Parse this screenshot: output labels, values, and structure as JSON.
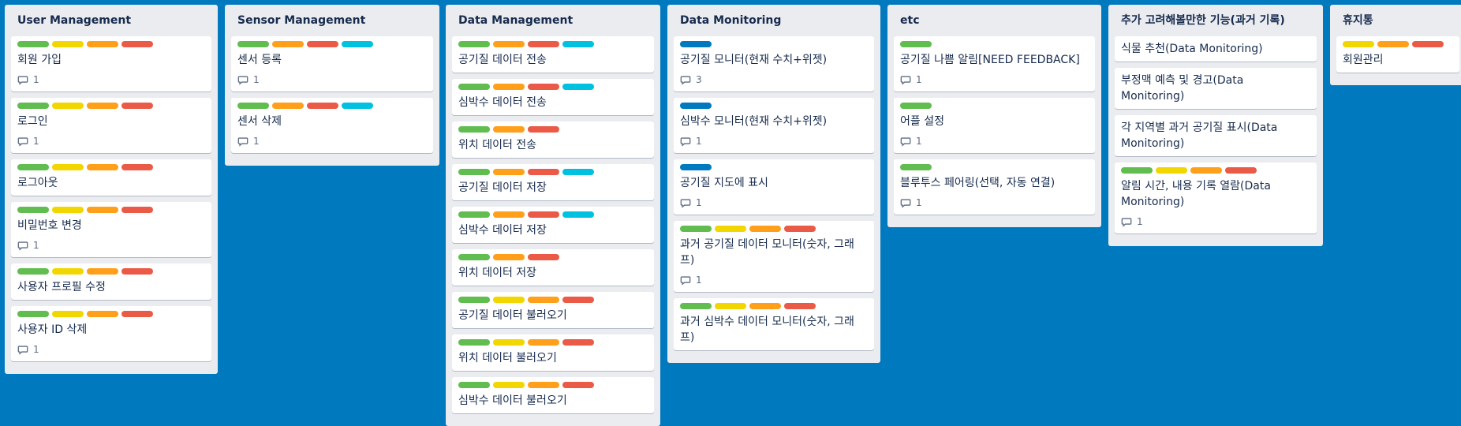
{
  "colors": {
    "background": "#0079bf",
    "list_bg": "#ebecf0",
    "card_bg": "#ffffff",
    "label_green": "#61bd4f",
    "label_yellow": "#f2d600",
    "label_orange": "#ff9f1a",
    "label_red": "#eb5a46",
    "label_sky": "#00c2e0",
    "label_blue": "#0079bf"
  },
  "lists": [
    {
      "title": "User Management",
      "cards": [
        {
          "title": "회원 가입",
          "labels": [
            "green",
            "yellow",
            "orange",
            "red"
          ],
          "comments": "1"
        },
        {
          "title": "로그인",
          "labels": [
            "green",
            "yellow",
            "orange",
            "red"
          ],
          "comments": "1"
        },
        {
          "title": "로그아웃",
          "labels": [
            "green",
            "yellow",
            "orange",
            "red"
          ],
          "comments": null
        },
        {
          "title": "비밀번호 변경",
          "labels": [
            "green",
            "yellow",
            "orange",
            "red"
          ],
          "comments": "1"
        },
        {
          "title": "사용자 프로필 수정",
          "labels": [
            "green",
            "yellow",
            "orange",
            "red"
          ],
          "comments": null
        },
        {
          "title": "사용자 ID 삭제",
          "labels": [
            "green",
            "yellow",
            "orange",
            "red"
          ],
          "comments": "1"
        }
      ]
    },
    {
      "title": "Sensor Management",
      "cards": [
        {
          "title": "센서 등록",
          "labels": [
            "green",
            "orange",
            "red",
            "sky"
          ],
          "comments": "1"
        },
        {
          "title": "센서 삭제",
          "labels": [
            "green",
            "orange",
            "red",
            "sky"
          ],
          "comments": "1"
        }
      ]
    },
    {
      "title": "Data Management",
      "cards": [
        {
          "title": "공기질 데이터 전송",
          "labels": [
            "green",
            "orange",
            "red",
            "sky"
          ],
          "comments": null
        },
        {
          "title": "심박수 데이터 전송",
          "labels": [
            "green",
            "orange",
            "red",
            "sky"
          ],
          "comments": null
        },
        {
          "title": "위치 데이터 전송",
          "labels": [
            "green",
            "orange",
            "red"
          ],
          "comments": null
        },
        {
          "title": "공기질 데이터 저장",
          "labels": [
            "green",
            "orange",
            "red",
            "sky"
          ],
          "comments": null
        },
        {
          "title": "심박수 데이터 저장",
          "labels": [
            "green",
            "orange",
            "red",
            "sky"
          ],
          "comments": null
        },
        {
          "title": "위치 데이터 저장",
          "labels": [
            "green",
            "orange",
            "red"
          ],
          "comments": null
        },
        {
          "title": "공기질 데이터 불러오기",
          "labels": [
            "green",
            "yellow",
            "orange",
            "red"
          ],
          "comments": null
        },
        {
          "title": "위치 데이터 불러오기",
          "labels": [
            "green",
            "yellow",
            "orange",
            "red"
          ],
          "comments": null
        },
        {
          "title": "심박수 데이터 불러오기",
          "labels": [
            "green",
            "yellow",
            "orange",
            "red"
          ],
          "comments": null
        }
      ]
    },
    {
      "title": "Data Monitoring",
      "cards": [
        {
          "title": "공기질 모니터(현재 수치+위젯)",
          "labels": [
            "blue"
          ],
          "comments": "3"
        },
        {
          "title": "심박수 모니터(현재 수치+위젯)",
          "labels": [
            "blue"
          ],
          "comments": "1"
        },
        {
          "title": "공기질 지도에 표시",
          "labels": [
            "blue"
          ],
          "comments": "1"
        },
        {
          "title": "과거 공기질 데이터 모니터(숫자, 그래프)",
          "labels": [
            "green",
            "yellow",
            "orange",
            "red"
          ],
          "comments": "1"
        },
        {
          "title": "과거 심박수 데이터 모니터(숫자, 그래프)",
          "labels": [
            "green",
            "yellow",
            "orange",
            "red"
          ],
          "comments": null
        }
      ]
    },
    {
      "title": "etc",
      "cards": [
        {
          "title": "공기질 나쁨 알림[NEED FEEDBACK]",
          "labels": [
            "green"
          ],
          "comments": "1"
        },
        {
          "title": "어플 설정",
          "labels": [
            "green"
          ],
          "comments": "1"
        },
        {
          "title": "블루투스 페어링(선택, 자동 연결)",
          "labels": [
            "green"
          ],
          "comments": "1"
        }
      ]
    },
    {
      "title": "추가 고려해볼만한 기능(과거 기록)",
      "cards": [
        {
          "title": "식물 추천(Data Monitoring)",
          "labels": [],
          "comments": null
        },
        {
          "title": "부정맥 예측 및 경고(Data Monitoring)",
          "labels": [],
          "comments": null
        },
        {
          "title": "각 지역별 과거 공기질 표시(Data Monitoring)",
          "labels": [],
          "comments": null
        },
        {
          "title": "알림 시간, 내용 기록 열람(Data Monitoring)",
          "labels": [
            "green",
            "yellow",
            "orange",
            "red"
          ],
          "comments": "1"
        }
      ]
    },
    {
      "title": "휴지통",
      "cards": [
        {
          "title": "회원관리",
          "labels": [
            "yellow",
            "orange",
            "red"
          ],
          "comments": null
        }
      ]
    }
  ]
}
